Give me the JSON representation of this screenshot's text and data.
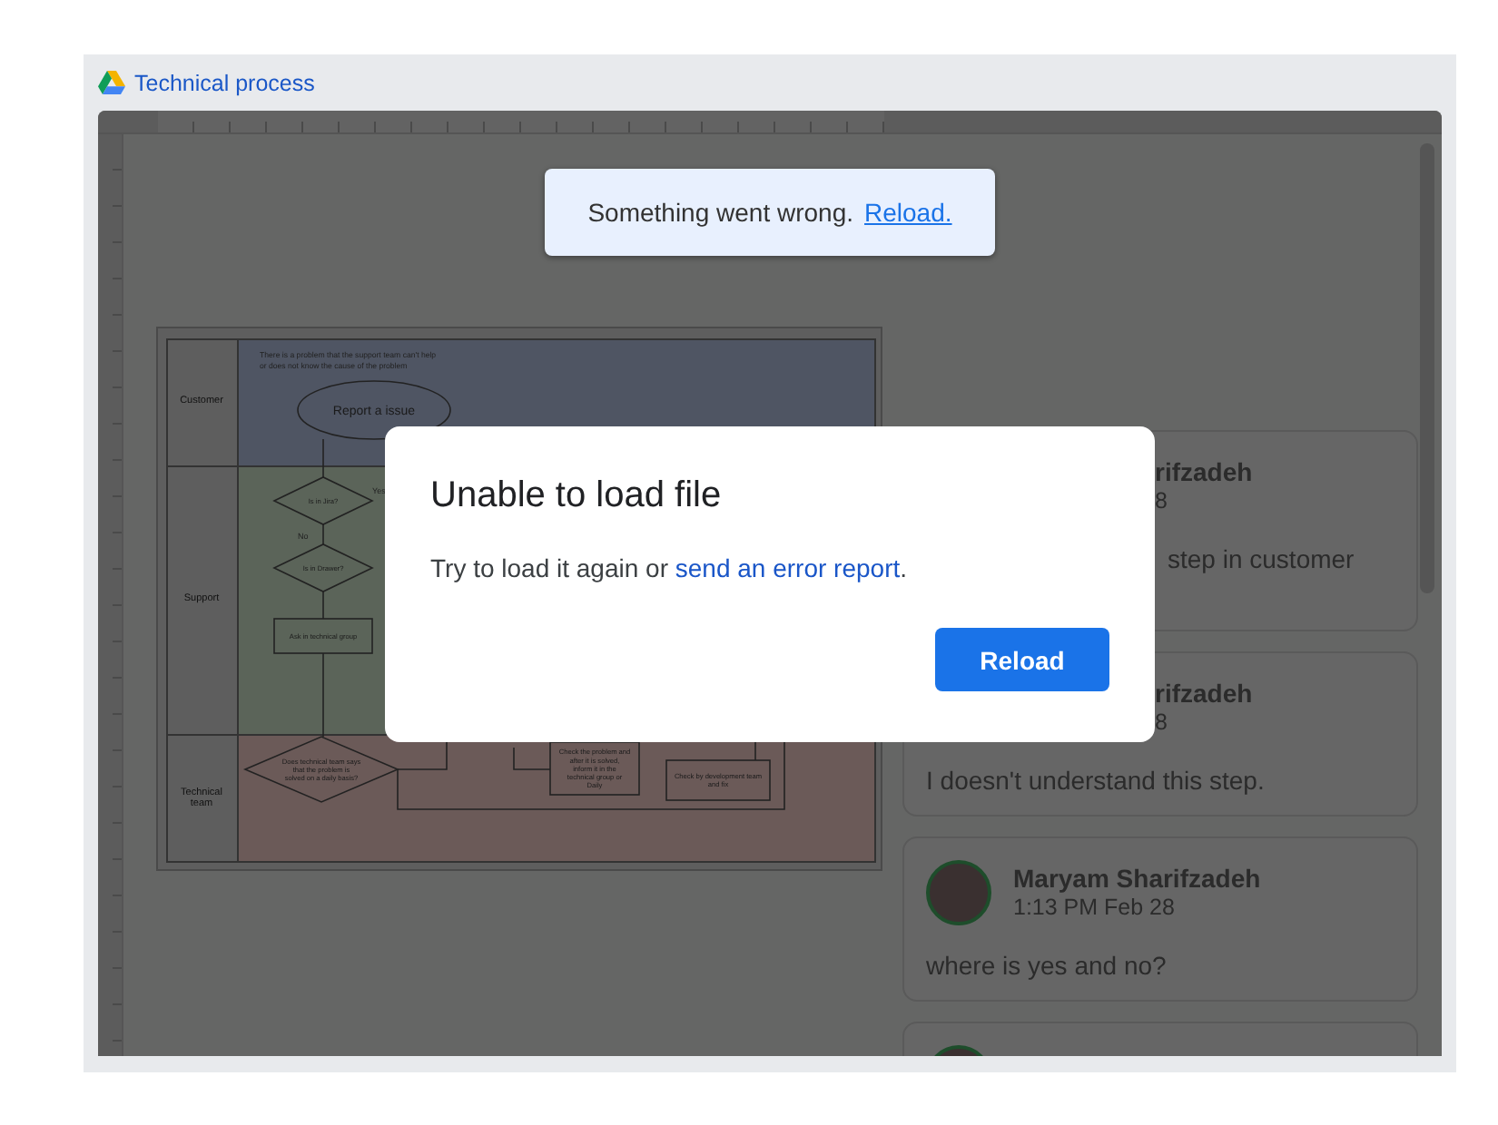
{
  "window": {
    "title": "Technical process"
  },
  "diagram": {
    "lanes": [
      {
        "label": "Customer",
        "color": "#4f5563"
      },
      {
        "label": "Support",
        "color": "#5b6459"
      },
      {
        "label": "Technical team",
        "color": "#6b5a58"
      }
    ],
    "note": "There is a problem that the support team can't help or does not know the cause of the problem",
    "nodes": [
      {
        "kind": "ellipse",
        "text": "Report a issue"
      },
      {
        "kind": "diamond",
        "text": "Is in Jira?"
      },
      {
        "kind": "diamond",
        "text": "Is in Drawer?"
      },
      {
        "kind": "process",
        "text": "Ask in technical group"
      },
      {
        "kind": "diamond",
        "text": "Does technical team says that the problem is solved on a daily basis?"
      },
      {
        "kind": "process",
        "text": "Check the problem and after it is solved, inform it in the technical group or Daily"
      },
      {
        "kind": "process",
        "text": "Check by development team and fix"
      }
    ],
    "edge_labels": [
      "Yes",
      "No"
    ]
  },
  "toast": {
    "message": "Something went wrong.",
    "link": "Reload."
  },
  "dialog": {
    "title": "Unable to load file",
    "message_before": "Try to load it again or ",
    "link": "send an error report",
    "message_after": ".",
    "button": "Reload"
  },
  "comments": [
    {
      "kind": "covered",
      "author": "rifzadeh",
      "time": "8",
      "text": "step in customer"
    },
    {
      "kind": "head-covered",
      "author": "rifzadeh",
      "time": "8",
      "text": "I doesn't understand this step."
    },
    {
      "kind": "full",
      "author": "Maryam Sharifzadeh",
      "time": "1:13 PM Feb 28",
      "text": "where is yes and no?"
    },
    {
      "kind": "cut"
    }
  ]
}
